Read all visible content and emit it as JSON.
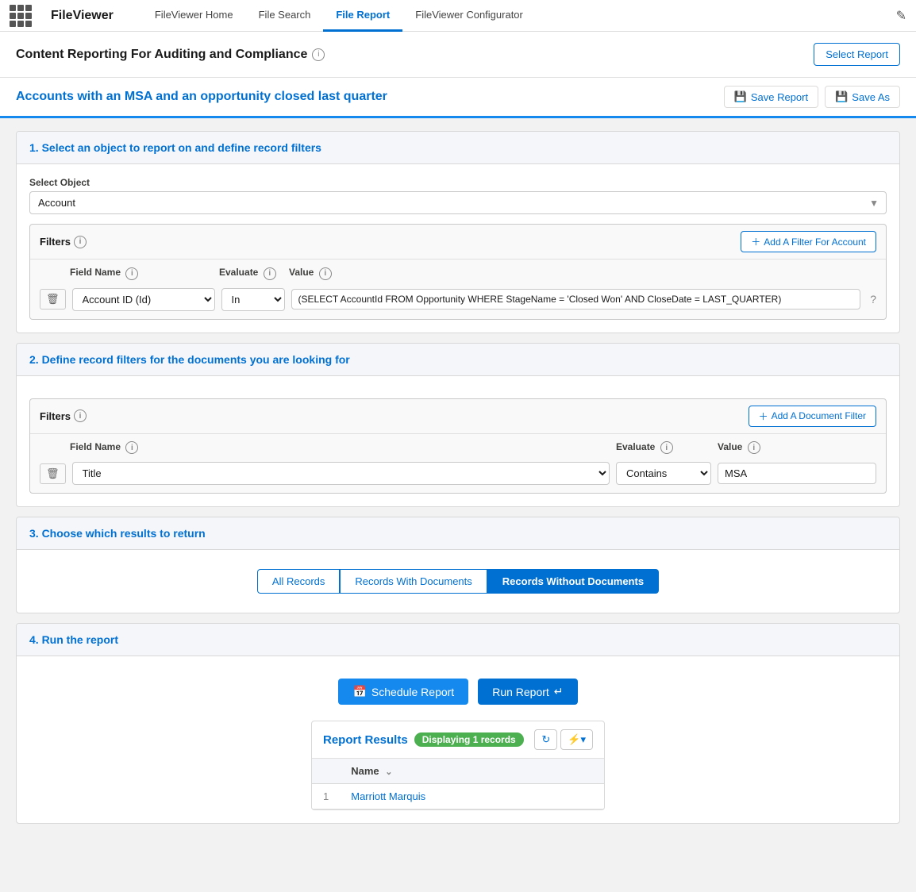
{
  "app": {
    "grid_icon": "⊞",
    "logo": "FileViewer",
    "nav": [
      {
        "label": "FileViewer Home",
        "active": false
      },
      {
        "label": "File Search",
        "active": false
      },
      {
        "label": "File Report",
        "active": true
      },
      {
        "label": "FileViewer Configurator",
        "active": false
      }
    ],
    "edit_icon": "✎"
  },
  "header": {
    "title": "Content Reporting For Auditing and Compliance",
    "info_icon": "i",
    "select_report_label": "Select Report"
  },
  "sub_header": {
    "report_title": "Accounts with an MSA and an opportunity closed last quarter",
    "save_report_label": "Save Report",
    "save_as_label": "Save As"
  },
  "section1": {
    "title": "1. Select an object to report on and define record filters",
    "select_object_label": "Select Object",
    "select_object_value": "Account",
    "filters_label": "Filters",
    "add_filter_label": "Add A Filter For Account",
    "filter_row": {
      "field_name_label": "Field Name",
      "evaluate_label": "Evaluate",
      "value_label": "Value",
      "field_name_value": "Account ID (Id)",
      "evaluate_value": "In",
      "value_text": "(SELECT AccountId FROM Opportunity WHERE StageName = 'Closed Won' AND CloseDate = LAST_QUARTER)"
    }
  },
  "section2": {
    "title": "2. Define record filters for the documents you are looking for",
    "filters_label": "Filters",
    "add_filter_label": "Add A Document Filter",
    "filter_row": {
      "field_name_label": "Field Name",
      "evaluate_label": "Evaluate",
      "value_label": "Value",
      "field_name_value": "Title",
      "evaluate_value": "Contains",
      "value_text": "MSA"
    }
  },
  "section3": {
    "title": "3. Choose which results to return",
    "buttons": [
      {
        "label": "All Records",
        "active": false
      },
      {
        "label": "Records With Documents",
        "active": false
      },
      {
        "label": "Records Without Documents",
        "active": true
      }
    ]
  },
  "section4": {
    "title": "4. Run the report",
    "schedule_label": "Schedule Report",
    "run_label": "Run Report"
  },
  "results": {
    "title": "Report Results",
    "displaying_badge": "Displaying 1 records",
    "column_name": "Name",
    "rows": [
      {
        "num": "1",
        "name": "Marriott Marquis"
      }
    ]
  }
}
